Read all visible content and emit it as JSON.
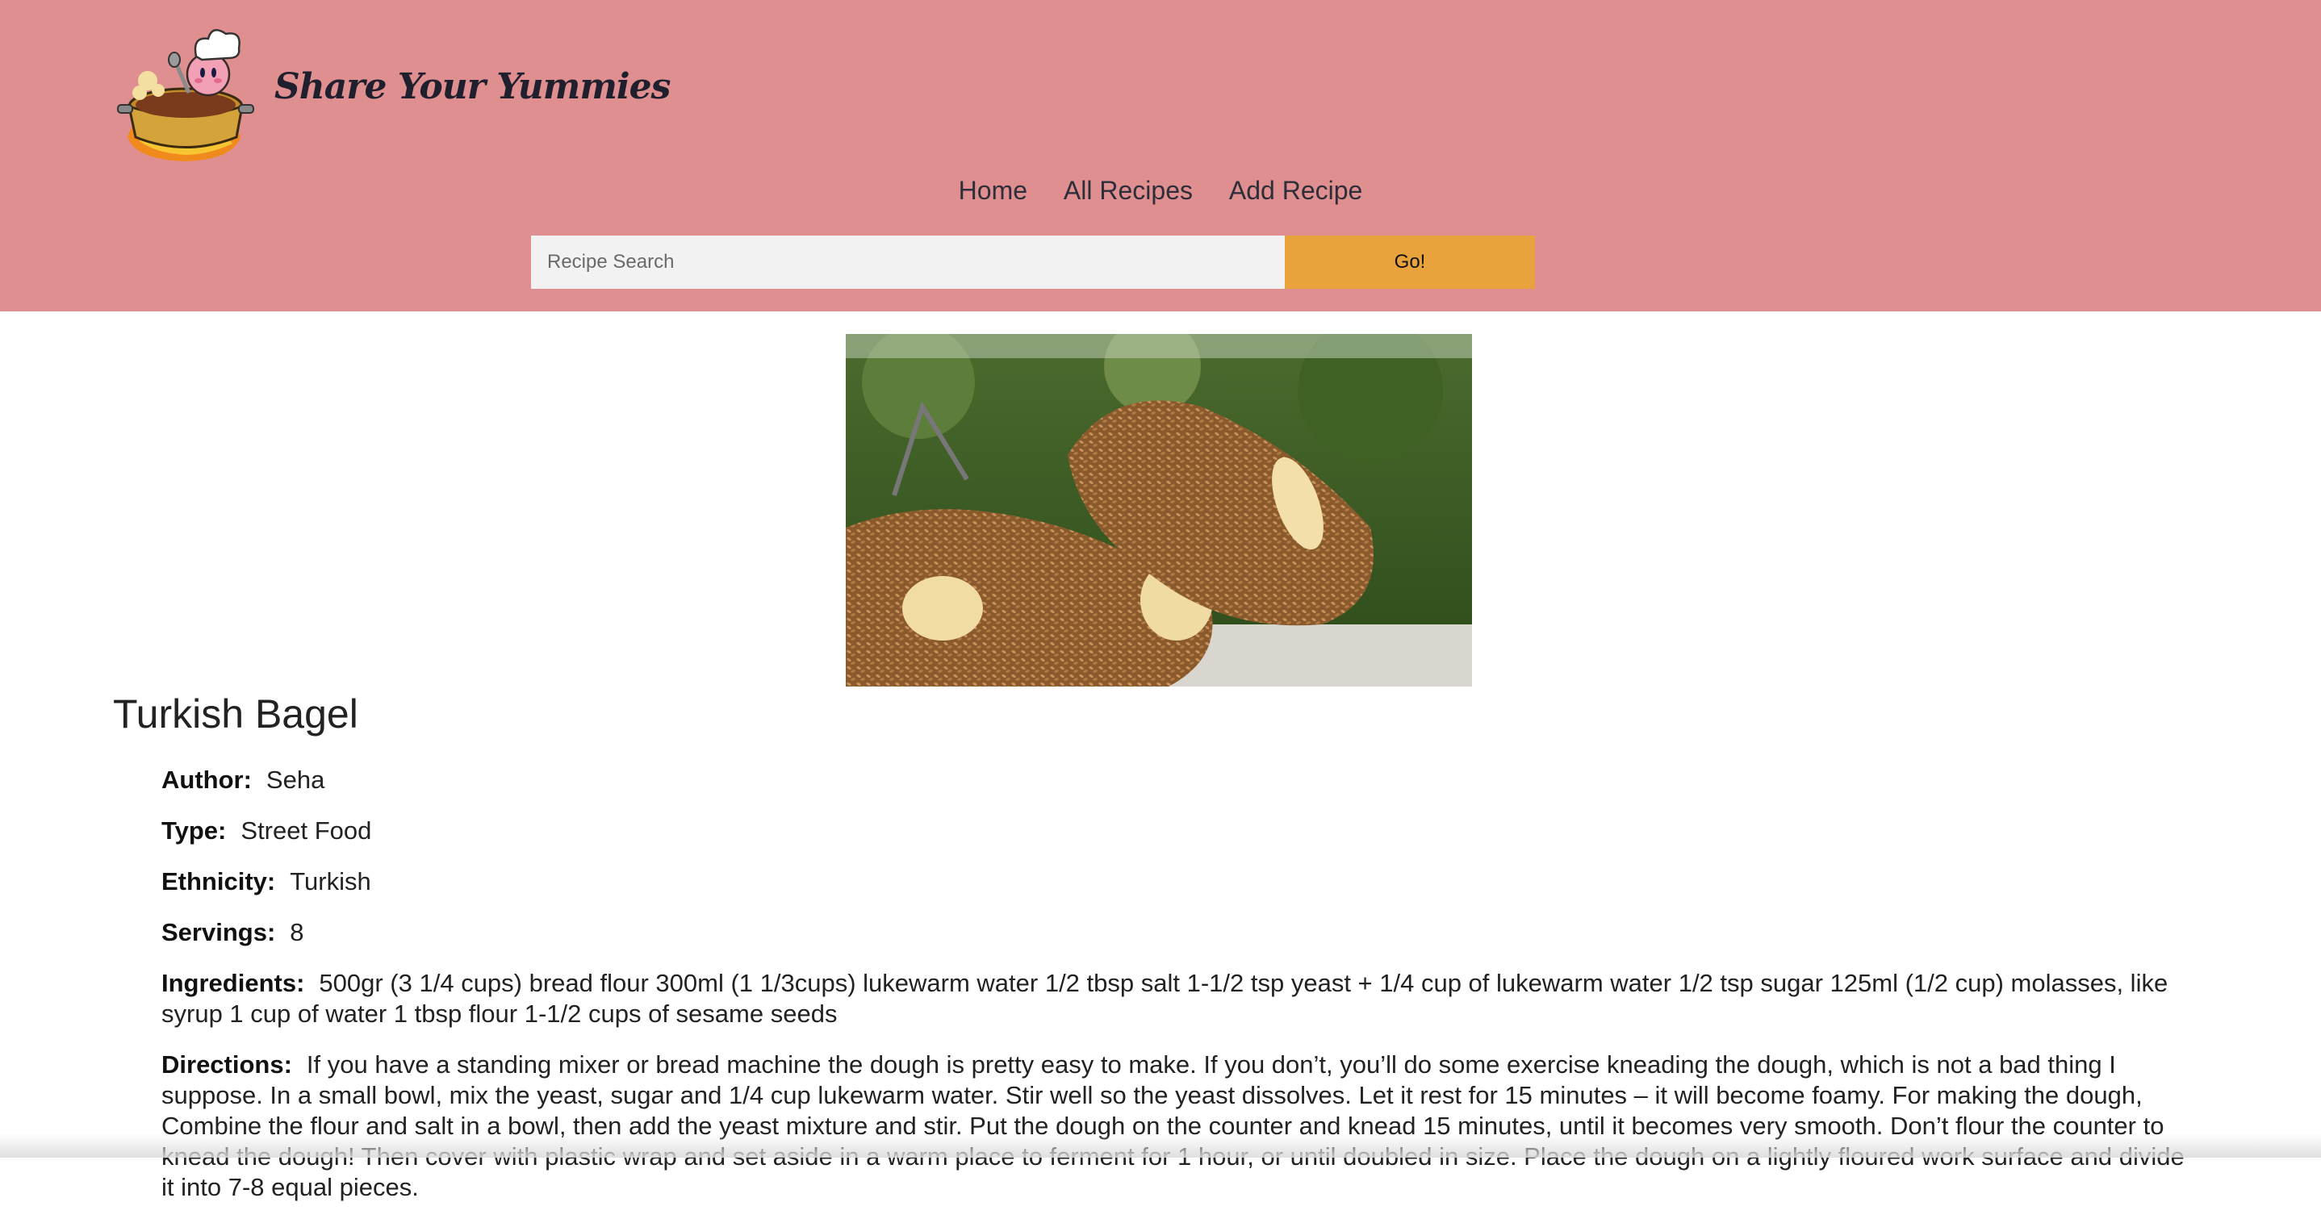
{
  "header": {
    "brand": "Share Your Yummies",
    "logo_icon": "chef-cooking-pot-icon",
    "bg_color": "#df8f8f",
    "nav": [
      "Home",
      "All Recipes",
      "Add Recipe"
    ],
    "search": {
      "placeholder": "Recipe Search",
      "value": "",
      "button_label": "Go!",
      "button_color": "#e9a33c"
    }
  },
  "recipe": {
    "image": "sesame-bagel-photo",
    "title": "Turkish Bagel",
    "author_label": "Author:",
    "author": "Seha",
    "type_label": "Type:",
    "type": "Street Food",
    "ethnicity_label": "Ethnicity:",
    "ethnicity": "Turkish",
    "servings_label": "Servings:",
    "servings": "8",
    "ingredients_label": "Ingredients:",
    "ingredients": "500gr (3 1/4 cups) bread flour 300ml (1 1/3cups) lukewarm water 1/2 tbsp salt 1-1/2 tsp yeast + 1/4 cup of lukewarm water 1/2 tsp sugar 125ml (1/2 cup) molasses, like syrup 1 cup of water 1 tbsp flour 1-1/2 cups of sesame seeds",
    "directions_label": "Directions:",
    "directions": "If you have a standing mixer or bread machine the dough is pretty easy to make. If you don’t, you’ll do some exercise kneading the dough, which is not a bad thing I suppose. In a small bowl, mix the yeast, sugar and 1/4 cup lukewarm water. Stir well so the yeast dissolves. Let it rest for 15 minutes – it will become foamy. For making the dough, Combine the flour and salt in a bowl, then add the yeast mixture and stir. Put the dough on the counter and knead 15 minutes, until it becomes very smooth. Don’t flour the counter to knead the dough! Then cover with plastic wrap and set aside in a warm place to ferment for 1 hour, or until doubled in size. Place the dough on a lightly floured work surface and divide it into 7-8 equal pieces."
  }
}
